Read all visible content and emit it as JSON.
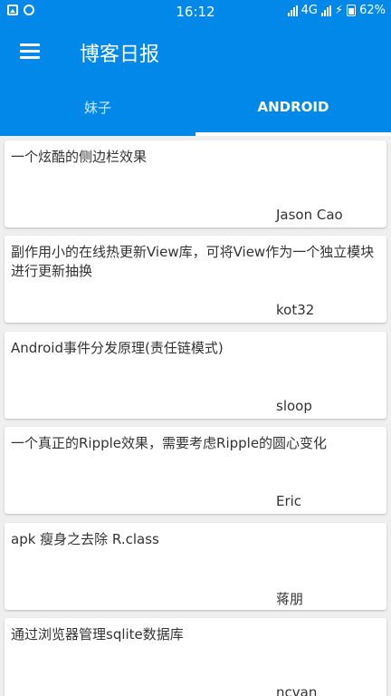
{
  "status_bar": {
    "time": "16:12",
    "network": "4G",
    "battery": "62%",
    "icons": [
      "gallery-icon",
      "alarm-icon",
      "signal-icon",
      "charging-icon",
      "battery-icon"
    ]
  },
  "app_bar": {
    "title": "博客日报",
    "menu_icon": "menu-icon",
    "color": "#0288e8"
  },
  "tabs": [
    {
      "label": "妹子",
      "active": false
    },
    {
      "label": "ANDROID",
      "active": true
    }
  ],
  "articles": [
    {
      "title": "一个炫酷的侧边栏效果",
      "author": "Jason Cao"
    },
    {
      "title": "副作用小的在线热更新View库，可将View作为一个独立模块进行更新抽换",
      "author": "kot32"
    },
    {
      "title": "Android事件分发原理(责任链模式)",
      "author": "sloop"
    },
    {
      "title": "一个真正的Ripple效果，需要考虑Ripple的圆心变化",
      "author": "Eric"
    },
    {
      "title": "apk 瘦身之去除 R.class",
      "author": "蒋朋"
    },
    {
      "title": "通过浏览器管理sqlite数据库",
      "author": "ncvan"
    }
  ]
}
